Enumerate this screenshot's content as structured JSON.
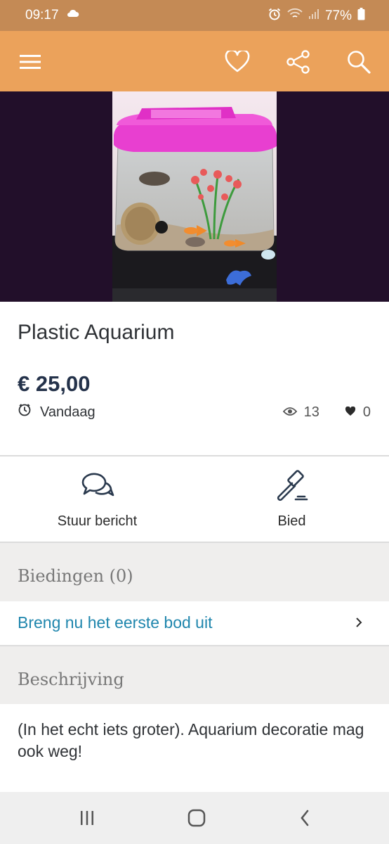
{
  "status_bar": {
    "time": "09:17",
    "battery": "77%"
  },
  "app_bar": {
    "icons": [
      "menu-icon",
      "heart-icon",
      "share-icon",
      "search-icon"
    ]
  },
  "listing": {
    "title": "Plastic Aquarium",
    "price": "€ 25,00",
    "date": "Vandaag",
    "views": "13",
    "likes": "0"
  },
  "actions": {
    "message_label": "Stuur bericht",
    "bid_label": "Bied"
  },
  "bids": {
    "heading": "Biedingen (0)",
    "first_bid_link": "Breng nu het eerste bod uit"
  },
  "description": {
    "heading": "Beschrijving",
    "text": "(In het echt iets groter). Aquarium decoratie mag ook weg!"
  },
  "colors": {
    "status_bar": "#c48a55",
    "app_bar": "#eba25b",
    "link": "#1f86ad",
    "price": "#24324a"
  }
}
